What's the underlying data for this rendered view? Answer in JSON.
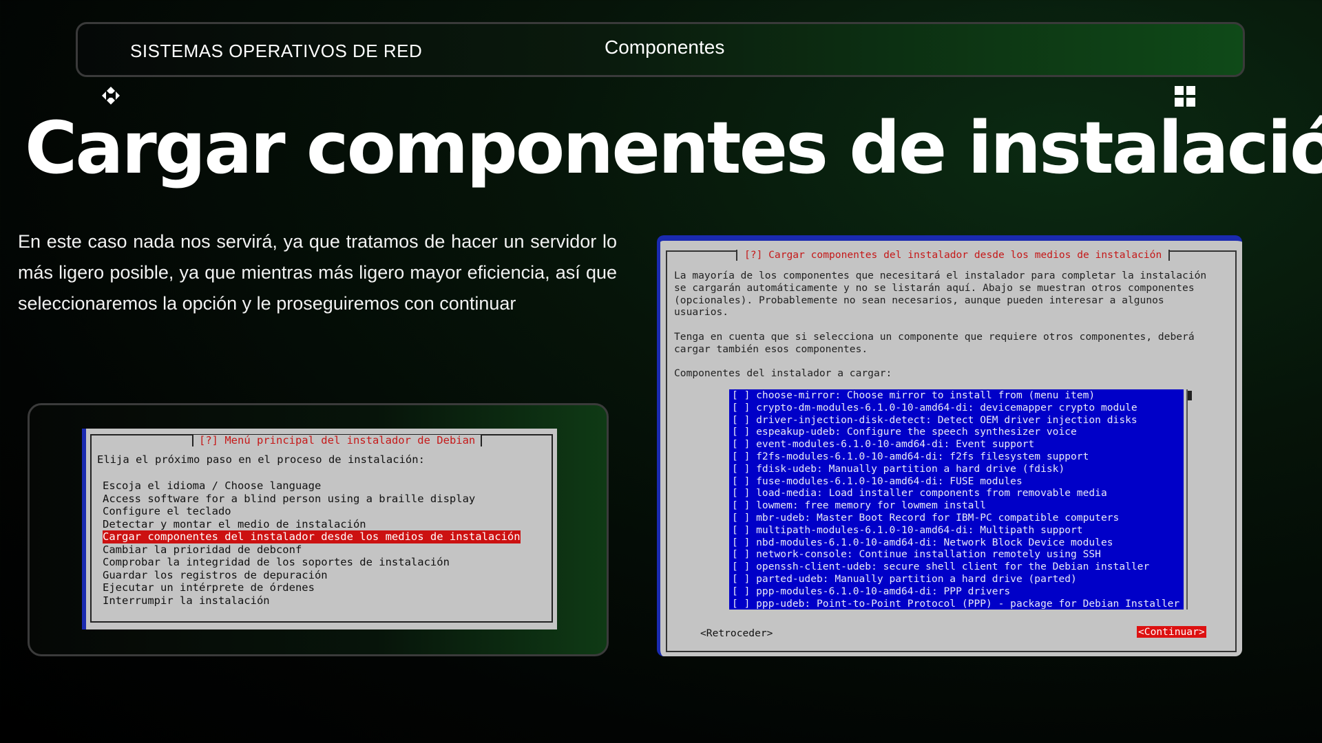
{
  "header": {
    "left": "SISTEMAS OPERATIVOS DE RED",
    "center": "Componentes"
  },
  "icons": {
    "left": "diamond-arrows-icon",
    "right": "grid-icon"
  },
  "title": "Cargar componentes de instalación",
  "description": "En este caso nada nos servirá, ya que tratamos de hacer un servidor lo más ligero posible, ya que mientras más ligero mayor eficiencia, así que seleccionaremos la opción y le proseguiremos con continuar",
  "menu_screenshot": {
    "title": "[?] Menú principal del instalador de Debian",
    "intro": "Elija el próximo paso en el proceso de instalación:",
    "items": [
      "Escoja el idioma / Choose language",
      "Access software for a blind person using a braille display",
      "Configure el teclado",
      "Detectar y montar el medio de instalación",
      "Cargar componentes del instalador desde los medios de instalación",
      "Cambiar la prioridad de debconf",
      "Comprobar la integridad de los soportes de instalación",
      "Guardar los registros de depuración",
      "Ejecutar un intérprete de órdenes",
      "Interrumpir la instalación"
    ],
    "selected_index": 4
  },
  "components_screenshot": {
    "title": "[?] Cargar componentes del instalador desde los medios de instalación",
    "paragraph1": "La mayoría de los componentes que necesitará el instalador para completar la instalación\nse cargarán automáticamente y no se listarán aquí. Abajo se muestran otros componentes\n(opcionales). Probablemente no sean necesarios, aunque pueden interesar a algunos\nusuarios.",
    "paragraph2": "Tenga en cuenta que si selecciona un componente que requiere otros componentes, deberá\ncargar también esos componentes.",
    "list_label": "Componentes del instalador a cargar:",
    "components": [
      "[ ] choose-mirror: Choose mirror to install from (menu item)",
      "[ ] crypto-dm-modules-6.1.0-10-amd64-di: devicemapper crypto module",
      "[ ] driver-injection-disk-detect: Detect OEM driver injection disks",
      "[ ] espeakup-udeb: Configure the speech synthesizer voice",
      "[ ] event-modules-6.1.0-10-amd64-di: Event support",
      "[ ] f2fs-modules-6.1.0-10-amd64-di: f2fs filesystem support",
      "[ ] fdisk-udeb: Manually partition a hard drive (fdisk)",
      "[ ] fuse-modules-6.1.0-10-amd64-di: FUSE modules",
      "[ ] load-media: Load installer components from removable media",
      "[ ] lowmem: free memory for lowmem install",
      "[ ] mbr-udeb: Master Boot Record for IBM-PC compatible computers",
      "[ ] multipath-modules-6.1.0-10-amd64-di: Multipath support",
      "[ ] nbd-modules-6.1.0-10-amd64-di: Network Block Device modules",
      "[ ] network-console: Continue installation remotely using SSH",
      "[ ] openssh-client-udeb: secure shell client for the Debian installer",
      "[ ] parted-udeb: Manually partition a hard drive (parted)",
      "[ ] ppp-modules-6.1.0-10-amd64-di: PPP drivers",
      "[ ] ppp-udeb: Point-to-Point Protocol (PPP) - package for Debian Installer"
    ],
    "back_button": "<Retroceder>",
    "continue_button": "<Continuar>"
  },
  "colors": {
    "accent_green": "#0f4a18",
    "debian_blue": "#0000c8",
    "highlight_red": "#cc1111"
  }
}
